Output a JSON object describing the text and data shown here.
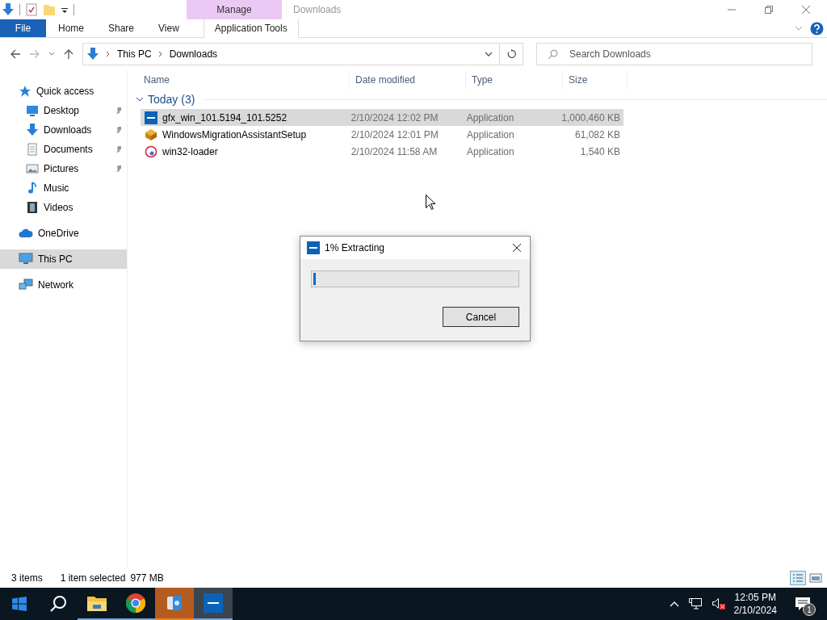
{
  "window": {
    "title": "Downloads",
    "context_group": "Manage"
  },
  "ribbon_tabs": [
    {
      "label": "File",
      "kind": "file",
      "selected": false
    },
    {
      "label": "Home",
      "kind": "normal",
      "selected": false
    },
    {
      "label": "Share",
      "kind": "normal",
      "selected": false
    },
    {
      "label": "View",
      "kind": "normal",
      "selected": false
    },
    {
      "label": "Application Tools",
      "kind": "contextual",
      "selected": false
    }
  ],
  "address": {
    "breadcrumbs": [
      "This PC",
      "Downloads"
    ],
    "search_placeholder": "Search Downloads"
  },
  "sidebar": [
    {
      "label": "Quick access",
      "kind": "star",
      "selected": false,
      "pinned": false,
      "children": [
        {
          "label": "Desktop",
          "kind": "desktop",
          "selected": false,
          "pinned": true
        },
        {
          "label": "Downloads",
          "kind": "download",
          "selected": false,
          "pinned": true
        },
        {
          "label": "Documents",
          "kind": "document",
          "selected": false,
          "pinned": true
        },
        {
          "label": "Pictures",
          "kind": "pictures",
          "selected": false,
          "pinned": true
        },
        {
          "label": "Music",
          "kind": "music",
          "selected": false,
          "pinned": false
        },
        {
          "label": "Videos",
          "kind": "video",
          "selected": false,
          "pinned": false
        }
      ]
    },
    {
      "label": "OneDrive",
      "kind": "cloud",
      "selected": false,
      "pinned": false
    },
    {
      "label": "This PC",
      "kind": "pc",
      "selected": true,
      "pinned": false
    },
    {
      "label": "Network",
      "kind": "network",
      "selected": false,
      "pinned": false
    }
  ],
  "table": {
    "columns": [
      "Name",
      "Date modified",
      "Type",
      "Size"
    ],
    "group": {
      "label": "Today (3)",
      "expanded": true
    },
    "rows": [
      {
        "name": "gfx_win_101.5194_101.5252",
        "kind": "intel",
        "date": "2/10/2024 12:02 PM",
        "type": "Application",
        "size": "1,000,460 KB",
        "selected": true
      },
      {
        "name": "WindowsMigrationAssistantSetup",
        "kind": "box",
        "date": "2/10/2024 12:01 PM",
        "type": "Application",
        "size": "61,082 KB",
        "selected": false
      },
      {
        "name": "win32-loader",
        "kind": "loader",
        "date": "2/10/2024 11:58 AM",
        "type": "Application",
        "size": "1,540 KB",
        "selected": false
      }
    ]
  },
  "status_bar": {
    "items": "3 items",
    "selected": "1 item selected",
    "size": "977 MB"
  },
  "dialog": {
    "title": "1% Extracting",
    "level": 0.01,
    "button": "Cancel"
  },
  "taskbar": {
    "apps": [
      {
        "kind": "explorer",
        "active": false,
        "running": true
      },
      {
        "kind": "chrome",
        "active": false,
        "running": true
      },
      {
        "kind": "migration",
        "active": false,
        "running": true
      },
      {
        "kind": "intel",
        "active": true,
        "running": true
      }
    ],
    "time": "12:05 PM",
    "date": "2/10/2024",
    "notifications": "1"
  }
}
